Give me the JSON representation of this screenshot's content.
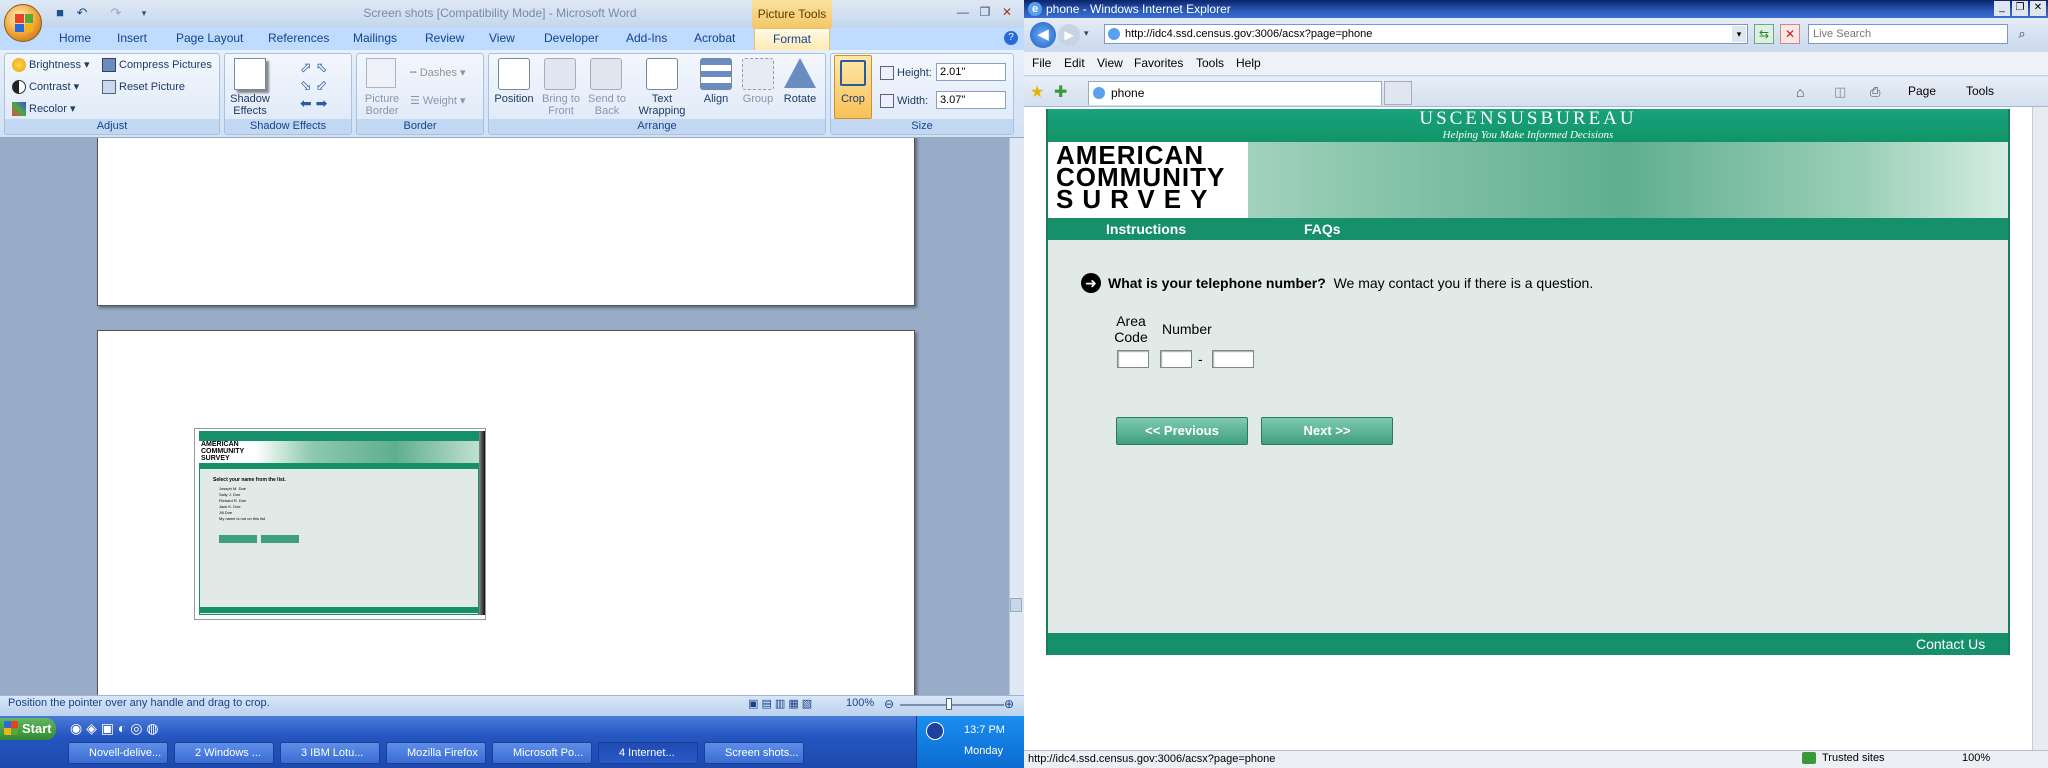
{
  "word": {
    "doc_title": "Screen shots [Compatibility Mode] - Microsoft Word",
    "contextual_tab": "Picture Tools",
    "tabs": [
      "Home",
      "Insert",
      "Page Layout",
      "References",
      "Mailings",
      "Review",
      "View",
      "Developer",
      "Add-Ins",
      "Acrobat",
      "Format"
    ],
    "adjust": {
      "brightness": "Brightness",
      "contrast": "Contrast",
      "recolor": "Recolor",
      "compress": "Compress Pictures",
      "reset": "Reset Picture",
      "label": "Adjust"
    },
    "shadow": {
      "effects": "Shadow Effects",
      "label": "Shadow Effects"
    },
    "border": {
      "picture_border": "Picture Border",
      "dashes": "Dashes",
      "weight": "Weight",
      "label": "Border"
    },
    "arrange": {
      "position": "Position",
      "bring_to_front": "Bring to Front",
      "send_to_back": "Send to Back",
      "text_wrapping": "Text Wrapping",
      "align": "Align",
      "group": "Group",
      "rotate": "Rotate",
      "label": "Arrange"
    },
    "size": {
      "crop": "Crop",
      "height_label": "Height:",
      "height_value": "2.01\"",
      "width_label": "Width:",
      "width_value": "3.07\"",
      "label": "Size"
    },
    "status_text": "Position the pointer over any handle and drag to crop.",
    "zoom": "100%"
  },
  "thumbnail": {
    "title_line": "AMERICAN COMMUNITY SURVEY",
    "question": "Select your name from the list.",
    "names": [
      "Joseph M. Doe",
      "Sally J. Doe",
      "Richard R. Doe",
      "Jack K. Doe",
      "Jill Doe",
      "My name is not on this list"
    ]
  },
  "taskbar": {
    "start": "Start",
    "items": [
      "Novell-delive...",
      "2 Windows ...",
      "3 IBM Lotu...",
      "Mozilla Firefox",
      "Microsoft Po...",
      "4 Internet...",
      "Screen shots..."
    ],
    "time": "13:7 PM",
    "day": "Monday"
  },
  "ie": {
    "window_title": "phone - Windows Internet Explorer",
    "address": "http://idc4.ssd.census.gov:3006/acsx?page=phone",
    "search_placeholder": "Live Search",
    "menu": [
      "File",
      "Edit",
      "View",
      "Favorites",
      "Tools",
      "Help"
    ],
    "tab_title": "phone",
    "page_btn": "Page",
    "tools_btn": "Tools",
    "status_url": "http://idc4.ssd.census.gov:3006/acsx?page=phone",
    "zone": "Trusted sites",
    "zoom": "100%"
  },
  "census": {
    "bureau": "USCENSUSBUREAU",
    "tagline": "Helping You Make Informed Decisions",
    "logo_lines": [
      "AMERICAN",
      "COMMUNITY",
      "SURVEY"
    ],
    "nav": [
      "Instructions",
      "FAQs"
    ],
    "question_bold": "What is your telephone number?",
    "question_rest": "We may contact you if there is a question.",
    "area_code_label": "Area Code",
    "number_label": "Number",
    "dash": "-",
    "prev_button": "<<  Previous",
    "next_button": "Next  >>",
    "contact": "Contact Us",
    "colors": {
      "green": "#16906a",
      "panel": "#e2eae7"
    }
  }
}
